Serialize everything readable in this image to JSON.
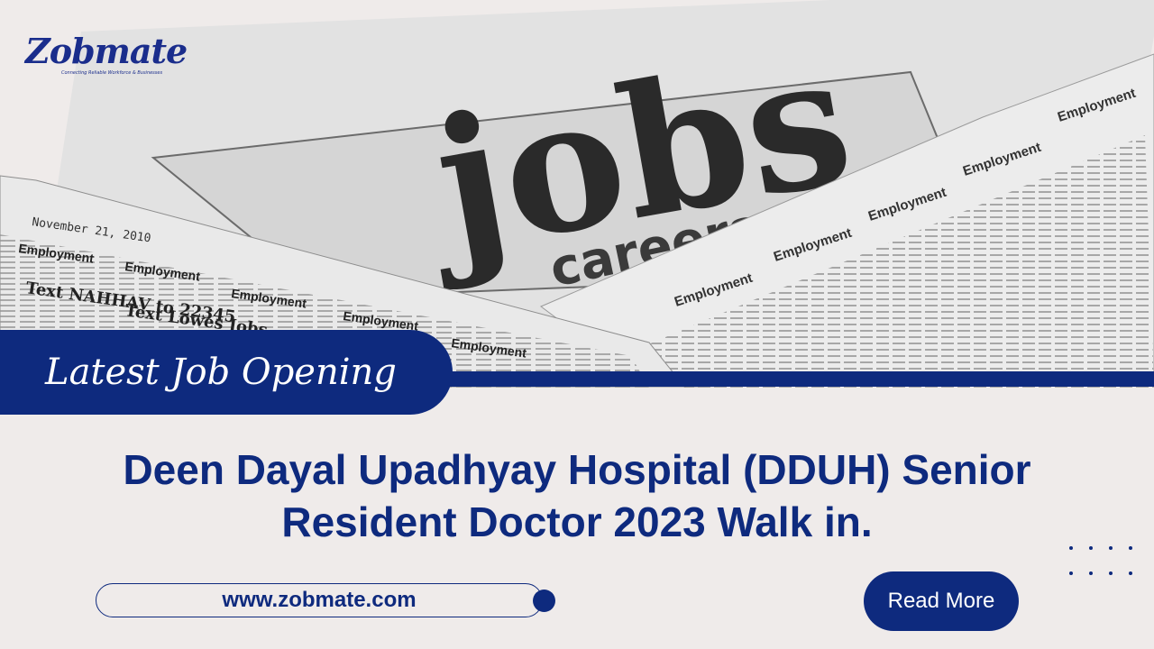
{
  "brand": {
    "name": "Zobmate",
    "tagline": "Connecting Reliable Workforce & Businesses",
    "colors": {
      "primary": "#0e2a7e",
      "background": "#efebea",
      "text_on_primary": "#ffffff"
    }
  },
  "banner": {
    "label": "Latest Job Opening",
    "headline_line1": "Deen Dayal Upadhyay Hospital (DDUH) Senior",
    "headline_line2": "Resident Doctor 2023 Walk in."
  },
  "footer": {
    "website": "www.zobmate.com",
    "read_more_label": "Read More"
  },
  "newspaper": {
    "headline_word": "jobs",
    "subheadline_word": "careers",
    "dateline": "November 21, 2010",
    "section_label": "Employment",
    "ad_text_1": "Text NAHHAV to 22345",
    "ad_text_2": "Text Lowes Jobs"
  },
  "decor": {
    "dot_grid_icon": "dot-grid-icon"
  }
}
